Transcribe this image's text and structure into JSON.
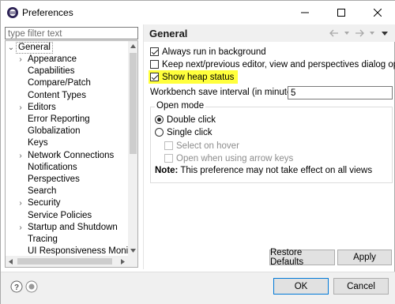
{
  "window": {
    "title": "Preferences",
    "minimize_symbol": "—",
    "maximize_symbol": "☐",
    "close_symbol": "✕"
  },
  "filter": {
    "placeholder": "type filter text",
    "value": ""
  },
  "tree": {
    "root": {
      "label": "General",
      "expanded": true,
      "selected": true
    },
    "items": [
      {
        "label": "Appearance",
        "expandable": true
      },
      {
        "label": "Capabilities",
        "expandable": false
      },
      {
        "label": "Compare/Patch",
        "expandable": false
      },
      {
        "label": "Content Types",
        "expandable": false
      },
      {
        "label": "Editors",
        "expandable": true
      },
      {
        "label": "Error Reporting",
        "expandable": false
      },
      {
        "label": "Globalization",
        "expandable": false
      },
      {
        "label": "Keys",
        "expandable": false
      },
      {
        "label": "Network Connections",
        "expandable": true
      },
      {
        "label": "Notifications",
        "expandable": false
      },
      {
        "label": "Perspectives",
        "expandable": false
      },
      {
        "label": "Search",
        "expandable": false
      },
      {
        "label": "Security",
        "expandable": true
      },
      {
        "label": "Service Policies",
        "expandable": false
      },
      {
        "label": "Startup and Shutdown",
        "expandable": true
      },
      {
        "label": "Tracing",
        "expandable": false
      },
      {
        "label": "UI Responsiveness Monitori",
        "expandable": false
      }
    ]
  },
  "page": {
    "title": "General",
    "options": {
      "always_run_background": {
        "label": "Always run in background",
        "checked": true
      },
      "keep_dialog_open": {
        "label": "Keep next/previous editor, view and perspectives dialog open",
        "checked": false
      },
      "show_heap_status": {
        "label": "Show heap status",
        "checked": true,
        "highlighted": true
      }
    },
    "save_interval": {
      "label": "Workbench save interval (in minutes):",
      "value": "5"
    },
    "open_mode": {
      "title": "Open mode",
      "double_click": {
        "label": "Double click",
        "selected": true
      },
      "single_click": {
        "label": "Single click",
        "selected": false
      },
      "select_on_hover": {
        "label": "Select on hover",
        "checked": false,
        "enabled": false
      },
      "open_arrow_keys": {
        "label": "Open when using arrow keys",
        "checked": false,
        "enabled": false
      },
      "note_bold": "Note:",
      "note_text": " This preference may not take effect on all views"
    },
    "restore_defaults_label": "Restore Defaults",
    "apply_label": "Apply"
  },
  "footer": {
    "ok_label": "OK",
    "cancel_label": "Cancel"
  },
  "colors": {
    "highlight": "#ffff3c",
    "accent_border": "#0078d7"
  }
}
